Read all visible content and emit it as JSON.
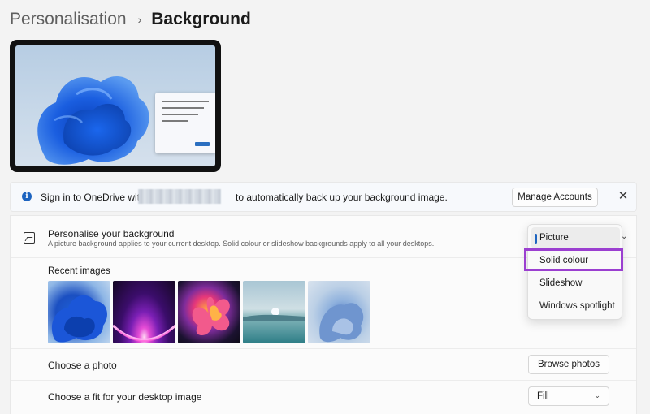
{
  "header": {
    "breadcrumb_parent": "Personalisation",
    "breadcrumb_separator": "›",
    "page_title": "Background"
  },
  "onedrive_banner": {
    "text_before": "Sign in to OneDrive with",
    "text_after": "to automatically back up your background image.",
    "manage_button": "Manage Accounts",
    "close_glyph": "✕",
    "info_glyph": "i"
  },
  "personalise": {
    "title": "Personalise your background",
    "description": "A picture background applies to your current desktop. Solid colour or slideshow backgrounds apply to all your desktops.",
    "current_value": "Picture",
    "chevron": "⌄",
    "icon": "image-icon"
  },
  "recent_images": {
    "label": "Recent images",
    "items": [
      "bloom-blue",
      "purple-glow",
      "orange-flower",
      "lake-sunrise",
      "blue-swirl"
    ]
  },
  "choose_photo": {
    "label": "Choose a photo",
    "button": "Browse photos"
  },
  "fit": {
    "label": "Choose a fit for your desktop image",
    "value": "Fill",
    "chevron": "⌄"
  },
  "dropdown": {
    "options": [
      "Picture",
      "Solid colour",
      "Slideshow",
      "Windows spotlight"
    ],
    "selected_index": 0,
    "highlighted_index": 1
  },
  "colors": {
    "accent": "#1d64c0",
    "highlight_box": "#9b3fd0"
  }
}
